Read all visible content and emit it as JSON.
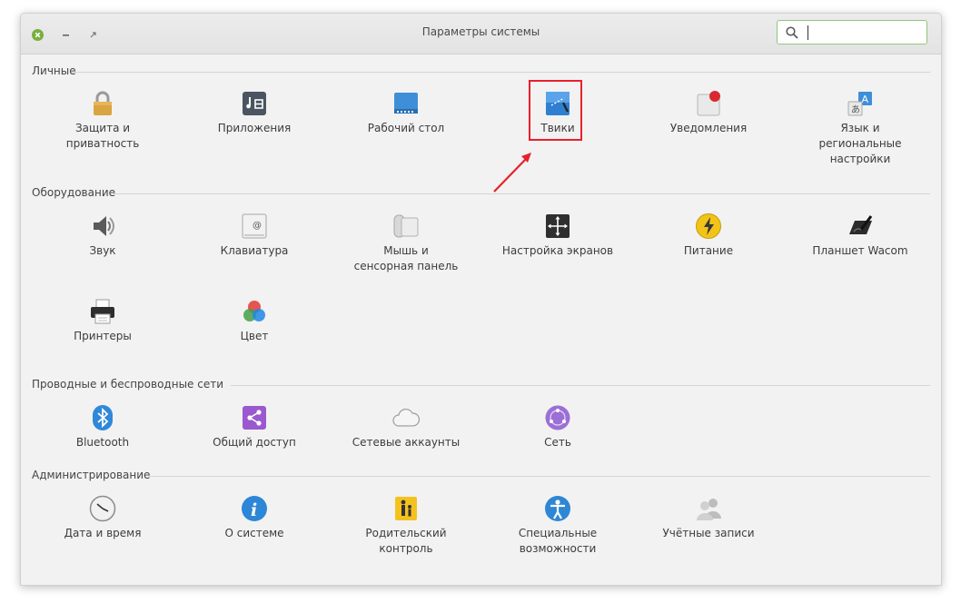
{
  "window": {
    "title": "Параметры системы",
    "search_placeholder": ""
  },
  "sections": {
    "personal": {
      "title": "Личные",
      "items": [
        "Защита и\nприватность",
        "Приложения",
        "Рабочий стол",
        "Твики",
        "Уведомления",
        "Язык и\nрегиональные\nнастройки"
      ]
    },
    "hardware": {
      "title": "Оборудование",
      "items": [
        "Звук",
        "Клавиатура",
        "Мышь и\nсенсорная панель",
        "Настройка экранов",
        "Питание",
        "Планшет Wacom",
        "Принтеры",
        "Цвет"
      ]
    },
    "network": {
      "title": "Проводные и беспроводные сети",
      "items": [
        "Bluetooth",
        "Общий доступ",
        "Сетевые аккаунты",
        "Сеть"
      ]
    },
    "admin": {
      "title": "Администрирование",
      "items": [
        "Дата и время",
        "О системе",
        "Родительский\nконтроль",
        "Специальные\nвозможности",
        "Учётные записи"
      ]
    }
  },
  "icons": {
    "personal": [
      "lock-icon",
      "applications-icon",
      "desktop-icon",
      "tweaks-icon",
      "notifications-icon",
      "language-icon"
    ],
    "hardware": [
      "speaker-icon",
      "keyboard-icon",
      "mouse-touchpad-icon",
      "display-icon",
      "power-icon",
      "wacom-tablet-icon",
      "printer-icon",
      "color-icon"
    ],
    "network": [
      "bluetooth-icon",
      "share-icon",
      "cloud-icon",
      "network-icon"
    ],
    "admin": [
      "clock-icon",
      "info-icon",
      "parental-control-icon",
      "accessibility-icon",
      "users-icon"
    ]
  },
  "colors": {
    "highlight": "#e8202a",
    "search_border": "#93c47d",
    "close_button": "#78b03c"
  }
}
